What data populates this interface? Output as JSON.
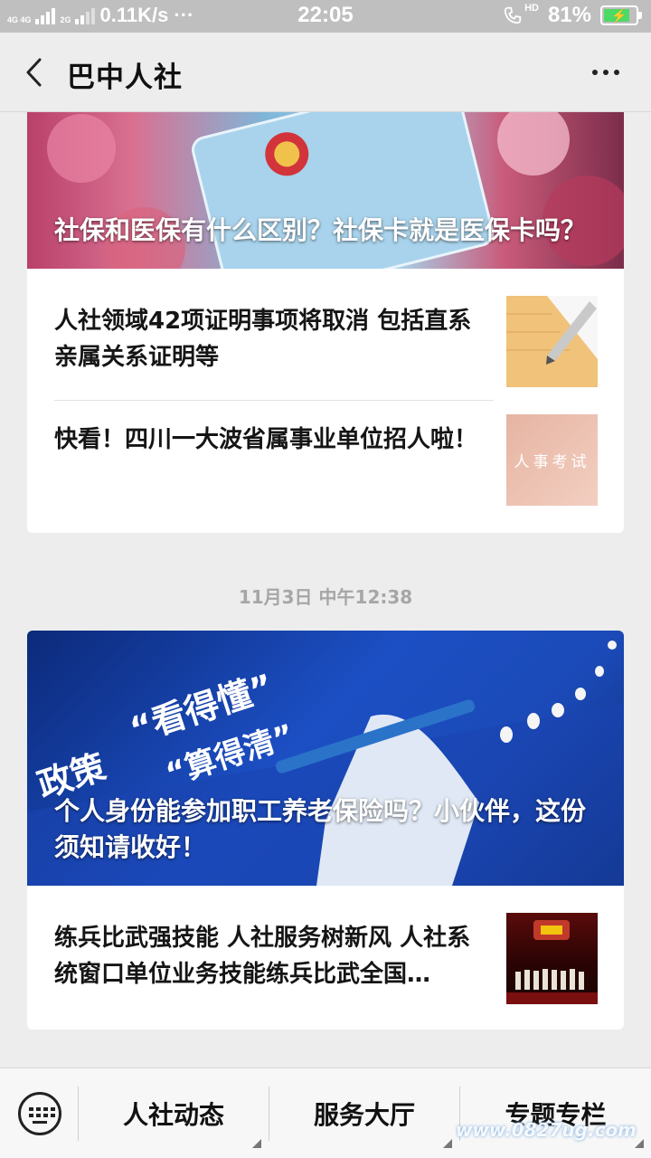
{
  "status_bar": {
    "net_labels": "4G 4G",
    "net2": "2G",
    "speed": "0.11K/s",
    "dots": "···",
    "time": "22:05",
    "hd": "HD",
    "battery_pct": "81%",
    "battery_level": 0.81
  },
  "header": {
    "title": "巴中人社"
  },
  "card1": {
    "cover_title": "社保和医保有什么区别？社保卡就是医保卡吗？",
    "items": [
      {
        "title": "人社领域42项证明事项将取消 包括直系亲属关系证明等"
      },
      {
        "title": "快看！四川一大波省属事业单位招人啦！",
        "thumb_text": "人事考试"
      }
    ]
  },
  "time_label": "11月3日 中午12:38",
  "card2": {
    "cover_title": "个人身份能参加职工养老保险吗？小伙伴，这份须知请收好！",
    "cover_text1": "政策",
    "cover_text2": "“看得懂”",
    "cover_text3": "“算得清”",
    "items": [
      {
        "title": "练兵比武强技能 人社服务树新风 人社系统窗口单位业务技能练兵比武全国…"
      }
    ]
  },
  "menu": {
    "items": [
      "人社动态",
      "服务大厅",
      "专题专栏"
    ],
    "watermark": "www.0827ug.com"
  }
}
